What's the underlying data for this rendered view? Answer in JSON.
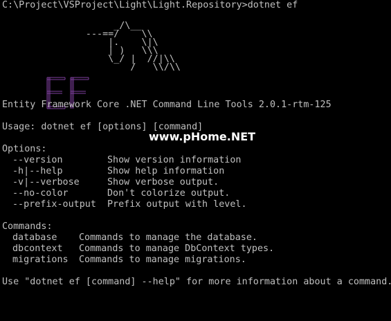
{
  "terminal": {
    "prompt_line": "C:\\Project\\VSProject\\Light\\Light.Repository>dotnet ef",
    "logo": {
      "art_lines": [
        "                    _/\\__",
        "               ---==/    \\\\",
        "                   |.    \\|\\",
        "                   | )   \\\\\\",
        "                   \\_/ |  //|\\\\",
        "                       /   \\\\/\\\\"
      ],
      "letters": "EF",
      "letters_color": "#7f3f9f"
    },
    "banner": "Entity Framework Core .NET Command Line Tools 2.0.1-rtm-125",
    "usage": "Usage: dotnet ef [options] [command]",
    "options_heading": "Options:",
    "options": [
      {
        "flag": "--version",
        "desc": "Show version information"
      },
      {
        "flag": "-h|--help",
        "desc": "Show help information"
      },
      {
        "flag": "-v|--verbose",
        "desc": "Show verbose output."
      },
      {
        "flag": "--no-color",
        "desc": "Don't colorize output."
      },
      {
        "flag": "--prefix-output",
        "desc": "Prefix output with level."
      }
    ],
    "commands_heading": "Commands:",
    "commands": [
      {
        "name": "database",
        "desc": "Commands to manage the database."
      },
      {
        "name": "dbcontext",
        "desc": "Commands to manage DbContext types."
      },
      {
        "name": "migrations",
        "desc": "Commands to manage migrations."
      }
    ],
    "footer": "Use \"dotnet ef [command] --help\" for more information about a command."
  },
  "watermark": "www.pHome.NET",
  "colors": {
    "background": "#000000",
    "text": "#c0c0c0",
    "logo_letters": "#7f3f9f"
  }
}
